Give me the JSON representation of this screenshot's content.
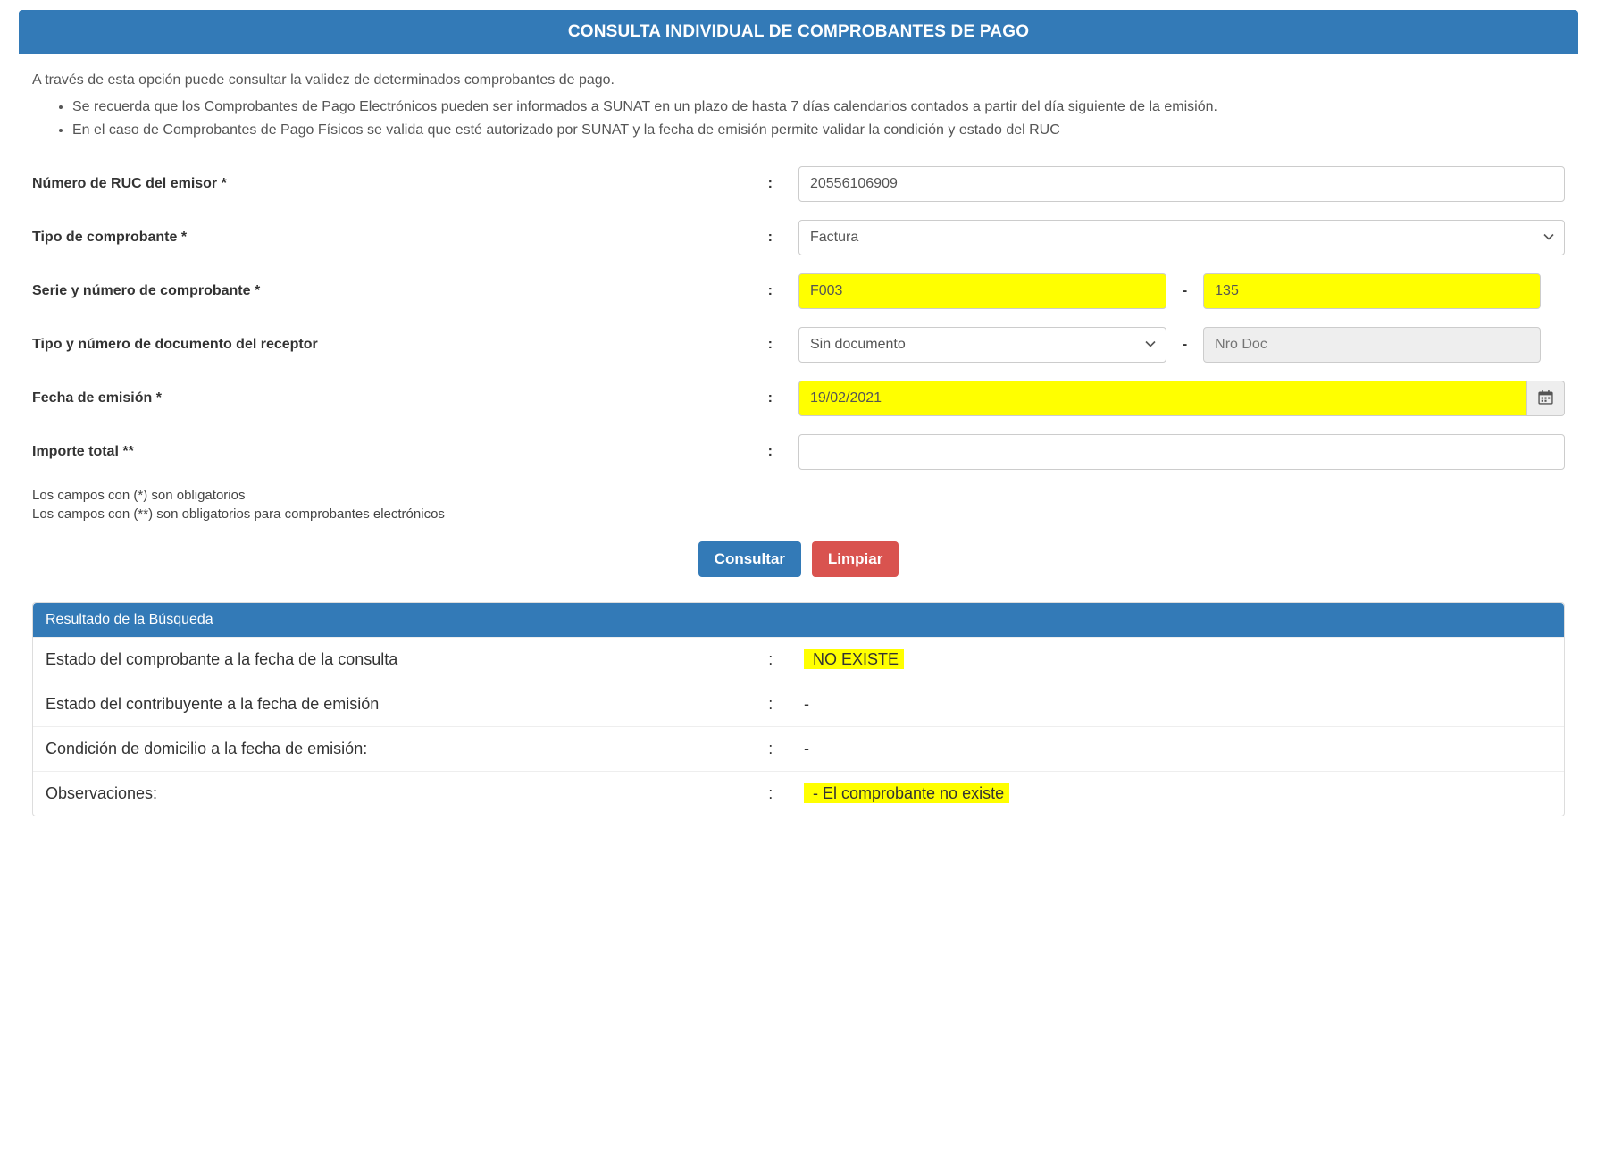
{
  "header": {
    "title": "CONSULTA INDIVIDUAL DE COMPROBANTES DE PAGO"
  },
  "intro": "A través de esta opción puede consultar la validez de determinados comprobantes de pago.",
  "bullets": [
    "Se recuerda que los Comprobantes de Pago Electrónicos pueden ser informados a SUNAT en un plazo de hasta 7 días calendarios contados a partir del día siguiente de la emisión.",
    "En el caso de Comprobantes de Pago Físicos se valida que esté autorizado por SUNAT y la fecha de emisión permite validar la condición y estado del RUC"
  ],
  "form": {
    "ruc": {
      "label": "Número de RUC del emisor *",
      "value": "20556106909"
    },
    "tipo": {
      "label": "Tipo de comprobante *",
      "value": "Factura"
    },
    "serie": {
      "label": "Serie y número de comprobante *",
      "serie": "F003",
      "numero": "135"
    },
    "receptor": {
      "label": "Tipo y número de documento del receptor",
      "tipo": "Sin documento",
      "nro_placeholder": "Nro Doc"
    },
    "fecha": {
      "label": "Fecha de emisión *",
      "value": "19/02/2021"
    },
    "importe": {
      "label": "Importe total **",
      "value": ""
    }
  },
  "notes": {
    "n1": "Los campos con (*) son obligatorios",
    "n2": "Los campos con (**) son obligatorios para comprobantes electrónicos"
  },
  "buttons": {
    "consultar": "Consultar",
    "limpiar": "Limpiar"
  },
  "result": {
    "title": "Resultado de la Búsqueda",
    "rows": {
      "estado_comprobante": {
        "label": "Estado del comprobante a la fecha de la consulta",
        "value": "NO EXISTE",
        "highlight": true
      },
      "estado_contribuyente": {
        "label": "Estado del contribuyente a la fecha de emisión",
        "value": "-",
        "highlight": false
      },
      "condicion": {
        "label": "Condición de domicilio a la fecha de emisión:",
        "value": "-",
        "highlight": false
      },
      "observaciones": {
        "label": "Observaciones:",
        "value": "- El comprobante no existe",
        "highlight": true
      }
    }
  }
}
